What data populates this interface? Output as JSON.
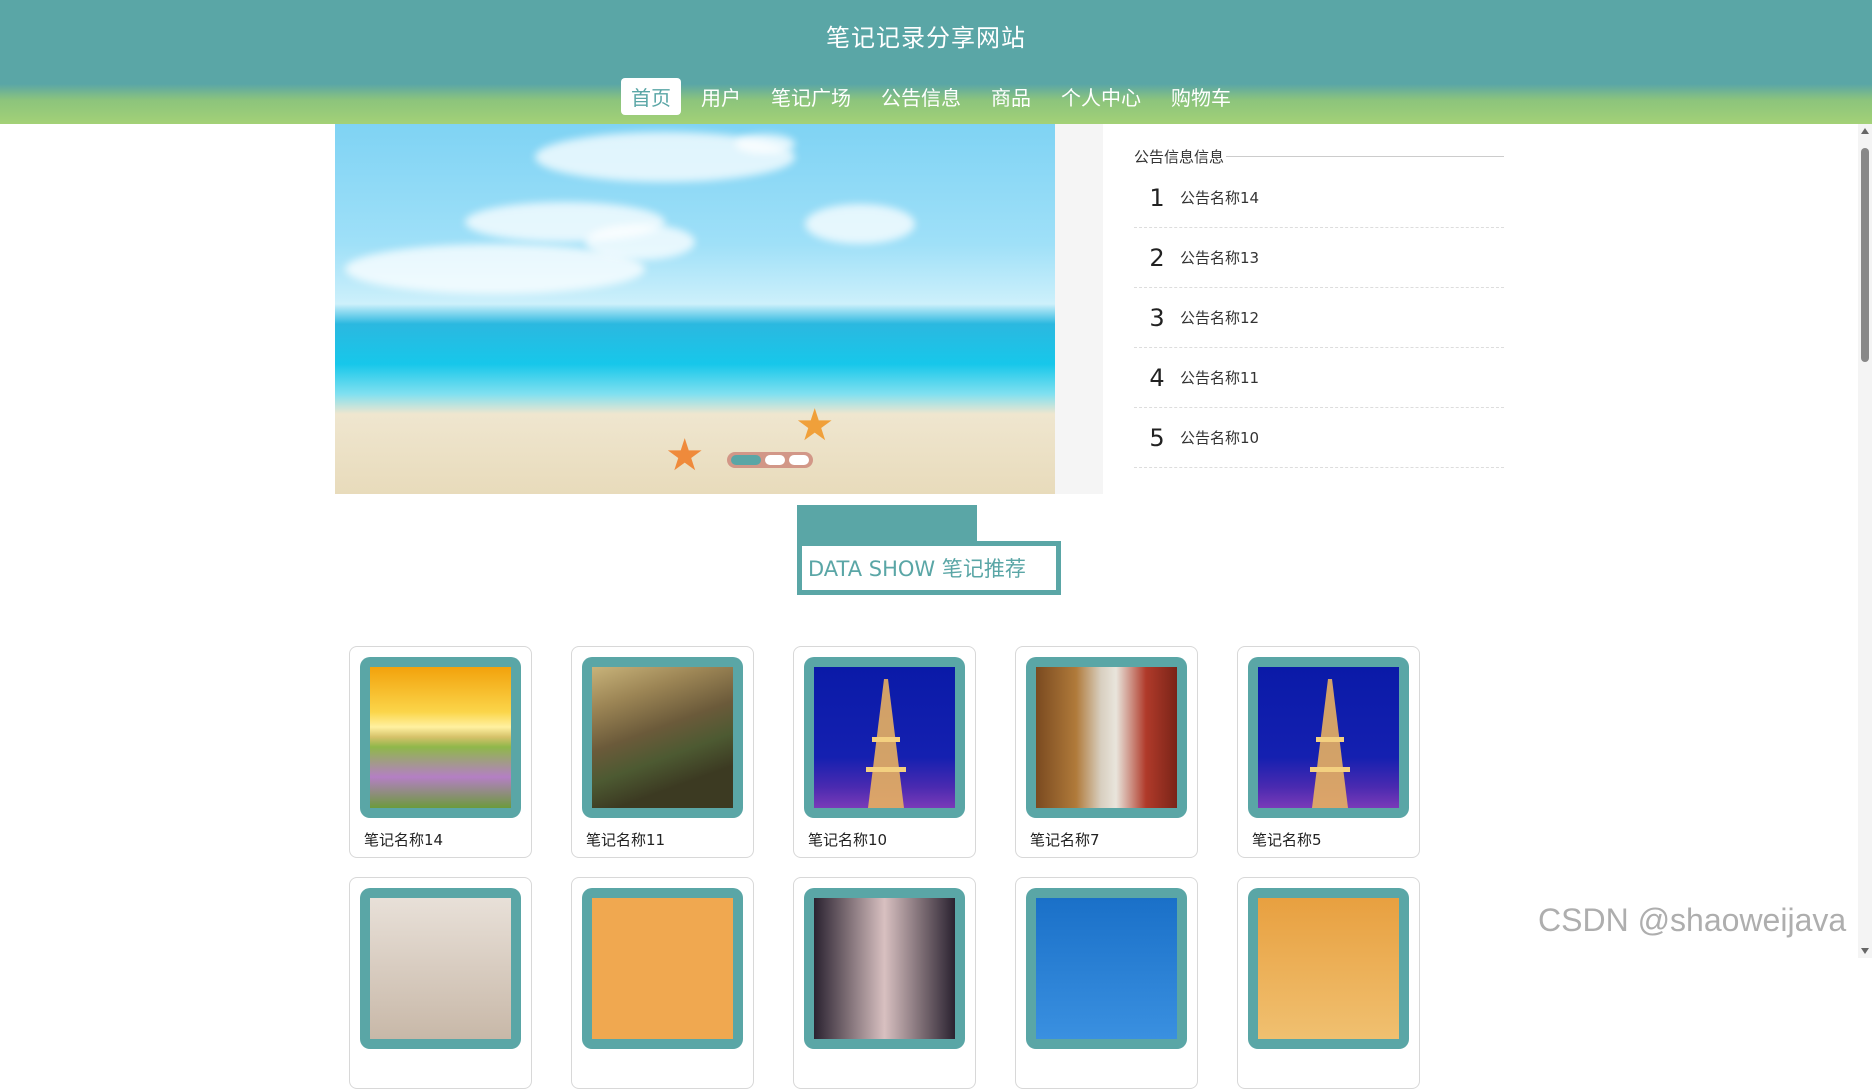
{
  "site": {
    "title": "笔记记录分享网站"
  },
  "nav": {
    "items": [
      {
        "label": "首页",
        "active": true
      },
      {
        "label": "用户",
        "active": false
      },
      {
        "label": "笔记广场",
        "active": false
      },
      {
        "label": "公告信息",
        "active": false
      },
      {
        "label": "商品",
        "active": false
      },
      {
        "label": "个人中心",
        "active": false
      },
      {
        "label": "购物车",
        "active": false
      }
    ]
  },
  "carousel": {
    "slide_count": 3,
    "active_index": 0
  },
  "notice": {
    "heading": "公告信息信息",
    "items": [
      {
        "num": "1",
        "title": "公告名称14"
      },
      {
        "num": "2",
        "title": "公告名称13"
      },
      {
        "num": "3",
        "title": "公告名称12"
      },
      {
        "num": "4",
        "title": "公告名称11"
      },
      {
        "num": "5",
        "title": "公告名称10"
      }
    ]
  },
  "recommend": {
    "title": "DATA SHOW 笔记推荐"
  },
  "notes": [
    {
      "title": "笔记名称14",
      "image": "sunset-flower-field"
    },
    {
      "title": "笔记名称11",
      "image": "mountain-valley"
    },
    {
      "title": "笔记名称10",
      "image": "eiffel-tower-night"
    },
    {
      "title": "笔记名称7",
      "image": "corridor-columns"
    },
    {
      "title": "笔记名称5",
      "image": "eiffel-tower-night"
    }
  ],
  "notes_row2": [
    {
      "title": "",
      "image": "blossom-branch"
    },
    {
      "title": "",
      "image": "cartoon-character"
    },
    {
      "title": "",
      "image": "portrait-hair"
    },
    {
      "title": "",
      "image": "blue-sky"
    },
    {
      "title": "",
      "image": "rainbow-sky"
    }
  ],
  "watermark": "CSDN @shaoweijava",
  "colors": {
    "primary": "#5aa6a6",
    "header_bottom": "#a3d177"
  }
}
